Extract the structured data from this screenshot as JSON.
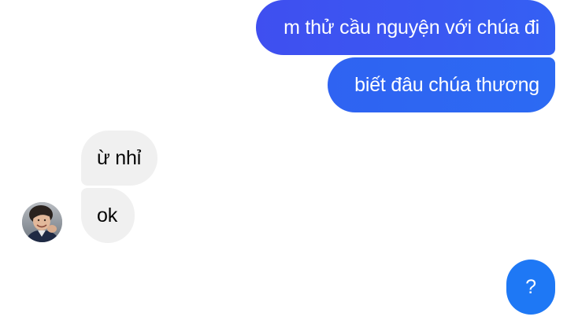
{
  "conversation": {
    "messages": [
      {
        "text": "m thử cầu nguyện với chúa đi",
        "sender": "me"
      },
      {
        "text": "biết đâu chúa thương",
        "sender": "me"
      },
      {
        "text": "ừ nhỉ",
        "sender": "other"
      },
      {
        "text": "ok",
        "sender": "other"
      },
      {
        "text": "?",
        "sender": "me"
      }
    ],
    "colors": {
      "outgoing_bubble": "#3a58f2",
      "outgoing_bubble_alt": "#2c6af3",
      "question_bubble": "#1e78f5",
      "incoming_bubble": "#f0f0f0",
      "incoming_text": "#050505",
      "outgoing_text": "#ffffff"
    },
    "avatar": {
      "icon": "user-avatar-photo"
    }
  }
}
